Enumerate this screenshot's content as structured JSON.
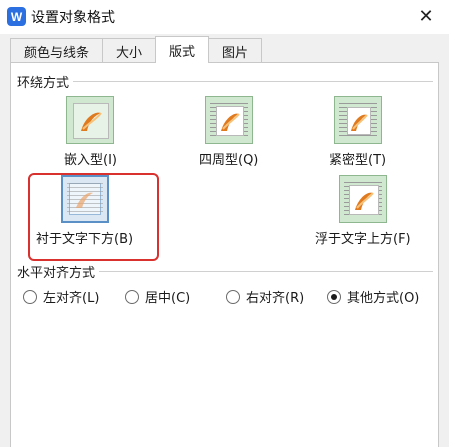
{
  "window": {
    "title": "设置对象格式",
    "app_icon_letter": "W",
    "close_glyph": "✕"
  },
  "tabs": [
    {
      "label": "颜色与线条",
      "active": false
    },
    {
      "label": "大小",
      "active": false
    },
    {
      "label": "版式",
      "active": true
    },
    {
      "label": "图片",
      "active": false
    }
  ],
  "wrapping": {
    "section_label": "环绕方式",
    "options": [
      {
        "label": "嵌入型(I)",
        "icon": "inline-wrap-icon"
      },
      {
        "label": "四周型(Q)",
        "icon": "square-wrap-icon"
      },
      {
        "label": "紧密型(T)",
        "icon": "tight-wrap-icon"
      },
      {
        "label": "衬于文字下方(B)",
        "icon": "behind-text-icon",
        "selected": true
      },
      {
        "label": "浮于文字上方(F)",
        "icon": "in-front-of-text-icon"
      }
    ]
  },
  "alignment": {
    "section_label": "水平对齐方式",
    "options": [
      {
        "label": "左对齐(L)",
        "checked": false
      },
      {
        "label": "居中(C)",
        "checked": false
      },
      {
        "label": "右对齐(R)",
        "checked": false
      },
      {
        "label": "其他方式(O)",
        "checked": true
      }
    ]
  },
  "colors": {
    "highlight": "#d9312e",
    "icon_fill": "#cfe8cf",
    "selected_fill": "#dbe8f4"
  }
}
